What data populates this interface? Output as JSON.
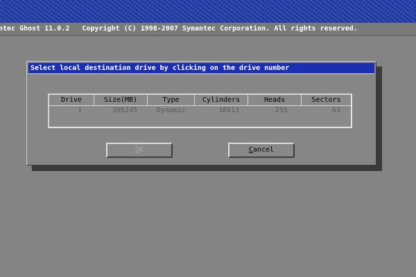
{
  "header": {
    "copyright": "ntec Ghost 11.0.2   Copyright (C) 1998-2007 Symantec Corporation. All rights reserved."
  },
  "dialog": {
    "title": "Select local destination drive by clicking on the drive number",
    "table": {
      "columns": [
        "Drive",
        "Size(MB)",
        "Type",
        "Cylinders",
        "Heads",
        "Sectors"
      ],
      "rows": [
        [
          "1",
          "305245",
          "Dynamic",
          "38913",
          "255",
          "63"
        ]
      ]
    },
    "buttons": {
      "ok_first": "O",
      "ok_rest": "K",
      "cancel_first": "C",
      "cancel_rest": "ancel"
    }
  },
  "colors": {
    "banner": "#1f3aa6",
    "title_bar": "#1c2fb0",
    "background": "#848484"
  }
}
